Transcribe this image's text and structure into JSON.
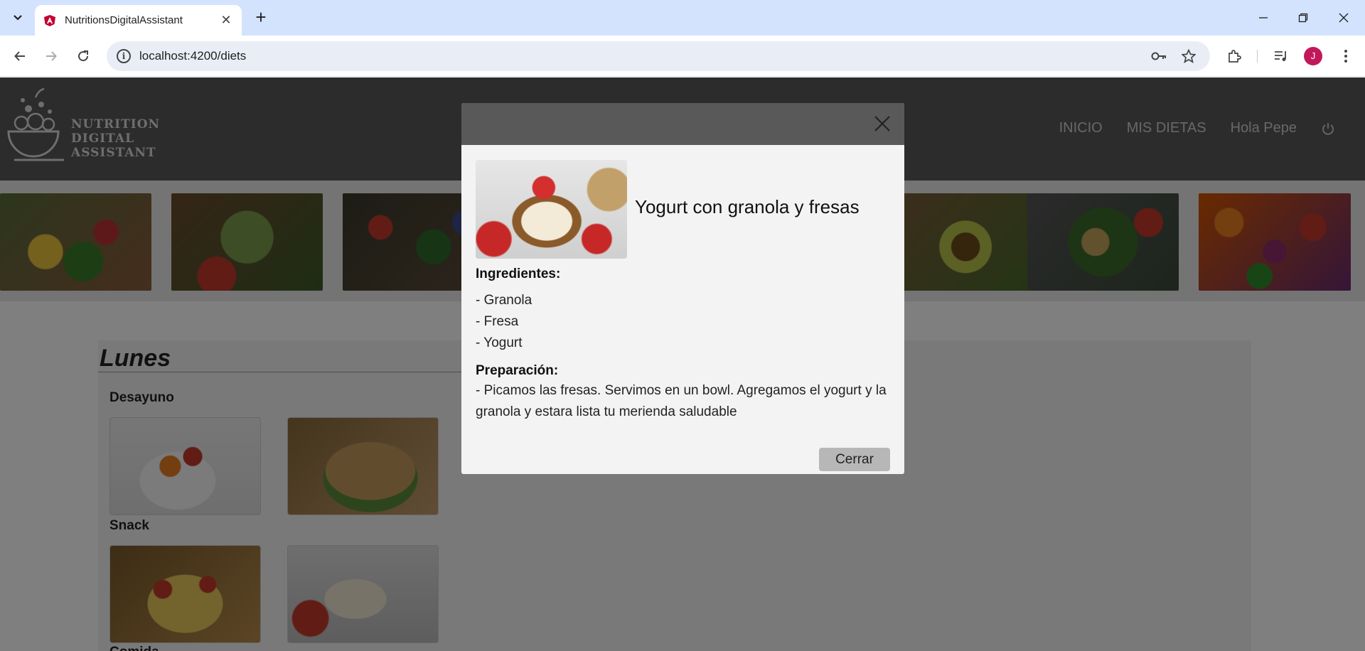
{
  "browser": {
    "tab_title": "NutritionsDigitalAssistant",
    "url": "localhost:4200/diets",
    "profile_initial": "J",
    "icons": [
      "tab-search-icon",
      "favicon-icon",
      "close-icon",
      "plus-icon",
      "minimize-icon",
      "restore-icon",
      "window-close-icon",
      "back-icon",
      "forward-icon",
      "reload-icon",
      "site-info-icon",
      "password-key-icon",
      "bookmark-star-icon",
      "extensions-icon",
      "media-control-icon",
      "more-icon"
    ]
  },
  "site": {
    "logo_lines": [
      "NUTRITION",
      "DIGITAL",
      "ASSISTANT"
    ],
    "nav": {
      "home": "INICIO",
      "diets": "MIS DIETAS",
      "greeting": "Hola Pepe"
    }
  },
  "plan": {
    "day": "Lunes",
    "meals": [
      "Desayuno",
      "Snack",
      "Comida"
    ]
  },
  "modal": {
    "title": "Yogurt con granola y fresas",
    "ingredients_label": "Ingredientes:",
    "ingredients": [
      "- Granola",
      "- Fresa",
      "- Yogurt"
    ],
    "preparation_label": "Preparación:",
    "preparation": "- Picamos las fresas. Servimos en un bowl. Agregamos el yogurt y la granola y estara lista tu merienda saludable",
    "close_button": "Cerrar"
  },
  "colors": {
    "tab_strip": "#d3e3fd",
    "site_header": "#595959",
    "profile_avatar": "#c2185b",
    "modal_body": "#f3f3f3",
    "modal_button": "#b7b7b7"
  }
}
